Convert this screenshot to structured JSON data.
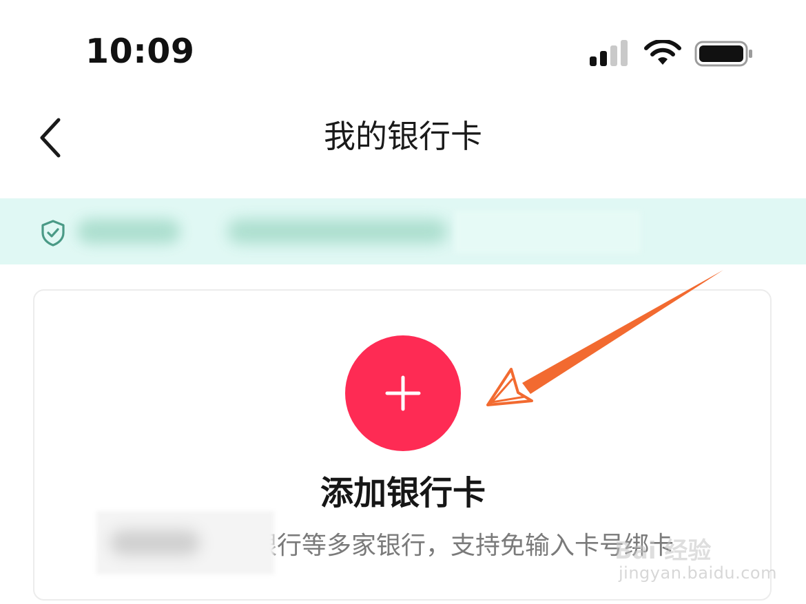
{
  "status_bar": {
    "time": "10:09",
    "signal_icon": "cellular-signal-icon",
    "wifi_icon": "wifi-icon",
    "battery_icon": "battery-icon"
  },
  "nav": {
    "back_icon": "chevron-left-icon",
    "title": "我的银行卡"
  },
  "security_banner": {
    "icon": "shield-check-icon",
    "background": "#e0f8f4",
    "icon_color": "#4a9a86"
  },
  "add_card": {
    "button_icon": "plus-icon",
    "button_color": "#fe2b54",
    "title": "添加银行卡",
    "subtitle": "银行等多家银行，支持免输入卡号绑卡"
  },
  "annotation": {
    "arrow_color": "#f26a30"
  },
  "watermark": {
    "brand": "Bai 经验",
    "url": "jingyan.baidu.com"
  }
}
